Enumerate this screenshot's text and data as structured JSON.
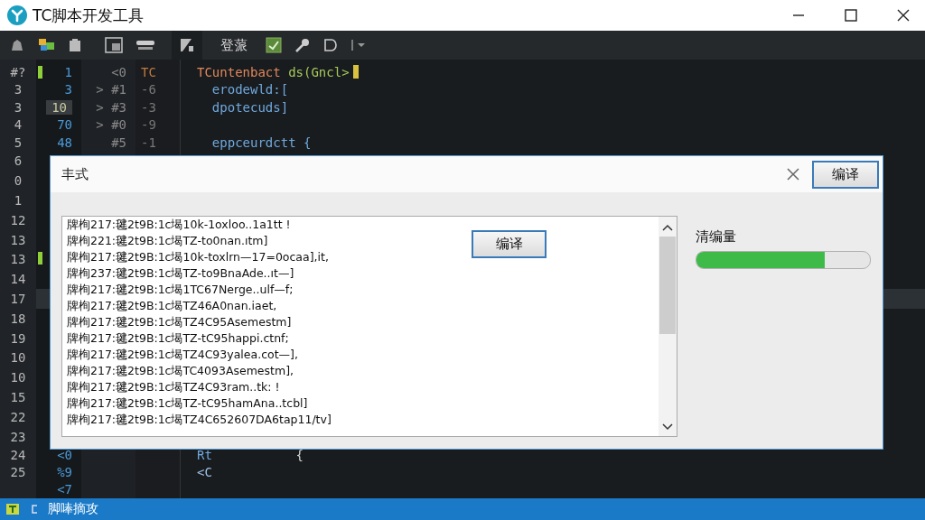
{
  "window": {
    "title": "TC脚本开发工具"
  },
  "toolbar": {
    "label": "登蒎"
  },
  "editor": {
    "rows": [
      {
        "num": "#?",
        "b": {
          "text": "1",
          "highlight": false
        },
        "c": "<0",
        "d": "TC",
        "marker": true,
        "current": false,
        "code": {
          "cursor": true,
          "tokens": [
            {
              "text": "TCuntenbact ",
              "kind": "type"
            },
            {
              "text": "ds(Gncl>",
              "kind": "call"
            }
          ]
        }
      },
      {
        "num": "3",
        "b": {
          "text": "3",
          "highlight": false
        },
        "c": "> #1",
        "d": "-6",
        "marker": false,
        "current": false,
        "code": {
          "cursor": false,
          "tokens": [
            {
              "text": "  erodewld:[",
              "kind": "ident"
            }
          ]
        }
      },
      {
        "num": "3",
        "b": {
          "text": "10",
          "highlight": true
        },
        "c": "> #3",
        "d": "-3",
        "marker": false,
        "current": false,
        "code": {
          "cursor": false,
          "tokens": [
            {
              "text": "  dpotecuds]",
              "kind": "ident"
            }
          ]
        }
      },
      {
        "num": "4",
        "b": {
          "text": "70",
          "highlight": false
        },
        "c": "> #0",
        "d": "-9",
        "marker": false,
        "current": false
      },
      {
        "num": "5",
        "b": {
          "text": "48",
          "highlight": false
        },
        "c": "#5",
        "d": "-1",
        "marker": false,
        "current": false,
        "code": {
          "cursor": false,
          "tokens": [
            {
              "text": "  eppceurdctt {",
              "kind": "ident"
            }
          ]
        }
      },
      {
        "num": "6",
        "marker": false,
        "current": false
      },
      {
        "num": "0",
        "marker": false,
        "current": false
      },
      {
        "num": "1",
        "marker": false,
        "current": false
      },
      {
        "num": "12",
        "marker": false,
        "current": false
      },
      {
        "num": "13",
        "marker": false,
        "current": false
      },
      {
        "num": "13",
        "marker": true,
        "current": false
      },
      {
        "num": "14",
        "marker": false,
        "current": false
      },
      {
        "num": "17",
        "marker": false,
        "current": true
      },
      {
        "num": "18",
        "marker": false,
        "current": false
      },
      {
        "num": "19",
        "marker": false,
        "current": false
      },
      {
        "num": "10",
        "marker": false,
        "current": false
      },
      {
        "num": "10",
        "marker": false,
        "current": false
      },
      {
        "num": "15",
        "marker": false,
        "current": false
      },
      {
        "num": "22",
        "marker": false,
        "current": false
      },
      {
        "num": "23",
        "marker": false,
        "current": false
      },
      {
        "num": "24",
        "b": {
          "text": "<0",
          "highlight": false
        },
        "marker": false,
        "current": false,
        "code": {
          "cursor": false,
          "tokens": [
            {
              "text": "Rt",
              "kind": "ident"
            },
            {
              "text": "           {",
              "kind": "plain"
            }
          ]
        }
      },
      {
        "num": "25",
        "b": {
          "text": "%9",
          "highlight": false
        },
        "marker": false,
        "current": false,
        "code": {
          "cursor": false,
          "tokens": [
            {
              "text": "<C",
              "kind": "tag"
            }
          ]
        }
      },
      {
        "b": {
          "text": "<7",
          "highlight": false
        },
        "marker": false,
        "current": false
      }
    ]
  },
  "dialog": {
    "title": "丰式",
    "header_button": "编译",
    "list_button": "编译",
    "lines": [
      "牌栒217:毽2t9B:1c堨10k-1oxloo..1a1tt !",
      "牌栒221:毽2t9B:1c堨TZ-to0nan.ıtm]",
      "牌栒217:毽2t9B:1c堨10k-toxlrn—17=0ocaa],it,",
      "牌栒237:毽2t9B:1c堨TZ-to9BnaAde..ıt—]",
      "牌栒217:毽2t9B:1c堨1TC67Nerge..ulf—f;",
      "牌栒217:毽2t9B:1c堨TZ46A0nan.iaet,",
      "牌栒217:毽2t9B:1c堨TZ4C95Asemestm]",
      "牌栒217:毽2t9B:1c堨TZ-tC95happi.ctnf;",
      "牌栒217:毽2t9B:1c堨TZ4C93yalea.cot—],",
      "牌栒217:毽2t9B:1c堨TC4093Asemestm],",
      "牌栒217:毽2t9B:1c堨TZ4C93ram..tk: !",
      "牌栒217:毽2t9B:1c堨TZ-tC95hamAna..tcbl]",
      "牌栒217:毽2t9B:1c堨TZ4C652607DA6tap11/tv]"
    ],
    "progress": {
      "label": "清编量",
      "level": 0.74
    }
  },
  "status_bar": {
    "text": "脚唪摘攻"
  }
}
